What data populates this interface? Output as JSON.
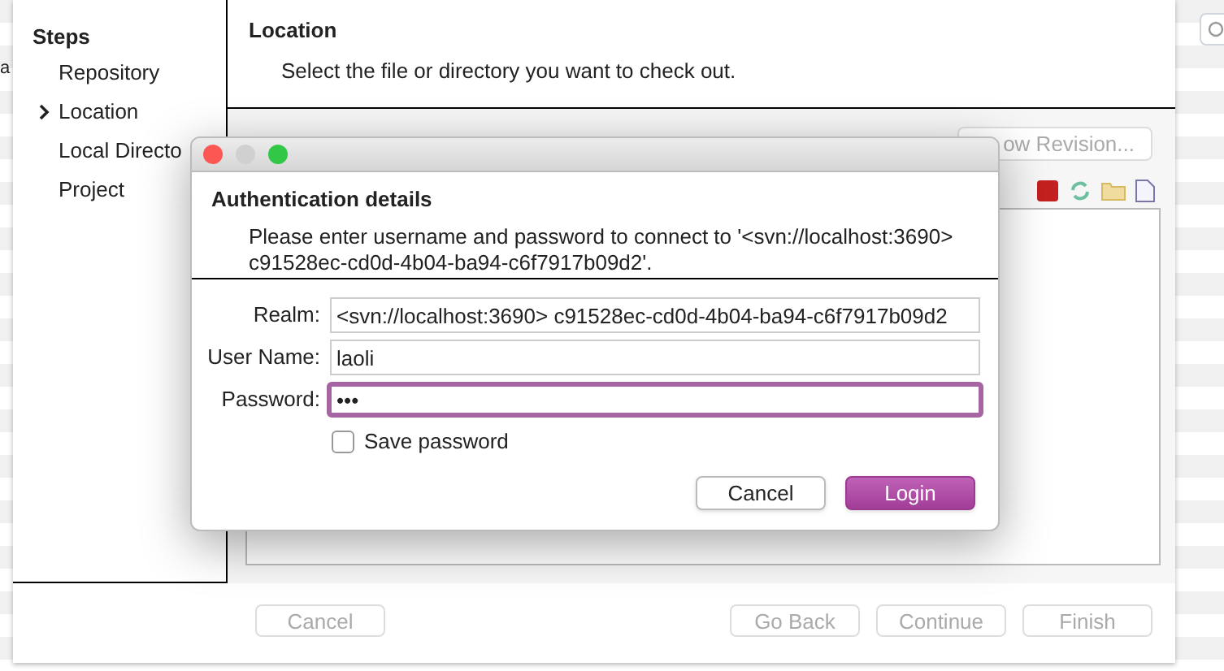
{
  "background_window": {
    "fragment": "a"
  },
  "wizard": {
    "sidebar": {
      "title": "Steps",
      "items": [
        {
          "label": "Repository",
          "selected": false
        },
        {
          "label": "Location",
          "selected": true
        },
        {
          "label": "Local Directo",
          "selected": false
        },
        {
          "label": "Project",
          "selected": false
        }
      ]
    },
    "header": {
      "title": "Location",
      "description": "Select the file or directory you want to check out."
    },
    "show_revision_button": {
      "label": "ow Revision...",
      "disabled": true
    },
    "buttons": [
      {
        "label": "Cancel",
        "disabled": true
      },
      {
        "label": "Go Back",
        "disabled": true
      },
      {
        "label": "Continue",
        "disabled": true
      },
      {
        "label": "Finish",
        "disabled": true
      }
    ]
  },
  "dialog": {
    "title": "Authentication details",
    "message": "Please enter username and password to connect to '<svn://localhost:3690> c91528ec-cd0d-4b04-ba94-c6f7917b09d2'.",
    "fields": [
      {
        "label": "Realm:",
        "value": "<svn://localhost:3690> c91528ec-cd0d-4b04-ba94-c6f7917b09d2",
        "focused": false
      },
      {
        "label": "User Name:",
        "value": "laoli",
        "focused": false
      },
      {
        "label": "Password:",
        "value": "•••",
        "focused": true
      }
    ],
    "save_password": {
      "label": "Save password",
      "checked": false
    },
    "buttons": [
      {
        "label": "Cancel",
        "kind": "default"
      },
      {
        "label": "Login",
        "kind": "primary"
      }
    ]
  }
}
